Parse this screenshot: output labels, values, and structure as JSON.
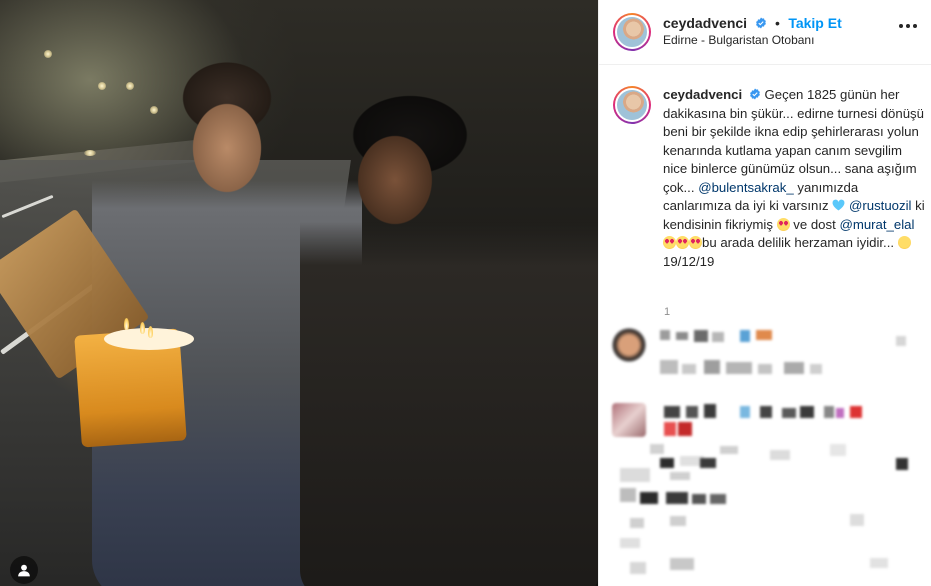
{
  "post": {
    "username": "ceydadvenci",
    "follow_label": "Takip Et",
    "dot": "•",
    "location": "Edirne - Bulgaristan Otobanı"
  },
  "caption": {
    "username": "ceydadvenci",
    "text_1": "Geçen 1825 günün her dakikasına bin şükür... edirne turnesi dönüşü beni bir şekilde ikna edip şehirlerarası yolun kenarında kutlama yapan canım sevgilim nice binlerce günümüz olsun... sana aşığım çok...",
    "mention_1": "@bulentsakrak_",
    "text_2": " yanımızda canlarımıza da iyi ki varsınız ",
    "mention_2": "@rustuozil",
    "text_3": " ki kendisinin fikriymiş ",
    "text_4": " ve dost ",
    "mention_3": "@murat_elal",
    "text_5": "bu arada delilik herzaman iyidir...",
    "text_6": " 19/12/19",
    "emoji_1": "smiling-face-with-heart-eyes",
    "emoji_2": "blue-heart",
    "emoji_3": "grinning-face-with-big-eyes"
  },
  "timeago": "1",
  "icons": {
    "verified": "verified-badge-icon",
    "more": "more-options-icon",
    "profile": "person-icon"
  },
  "colors": {
    "accent": "#0095f6",
    "mention": "#00376b",
    "verified": "#3897f0",
    "text": "#262626"
  }
}
